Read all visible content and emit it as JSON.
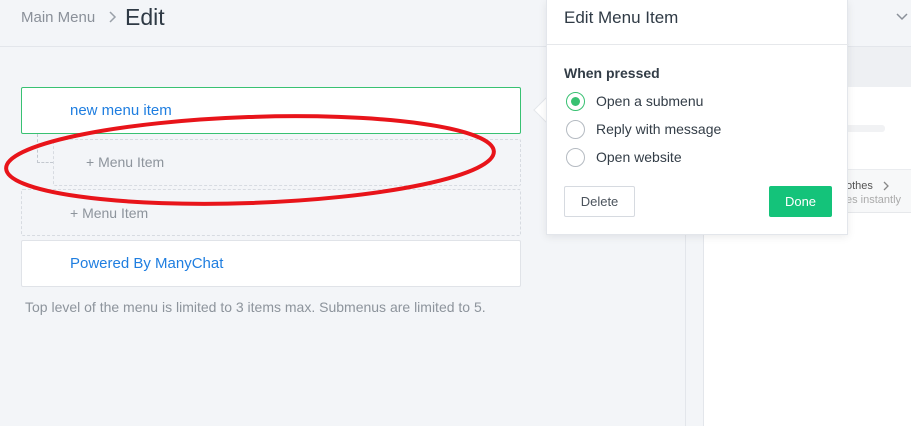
{
  "breadcrumb": {
    "main": "Main Menu",
    "current": "Edit"
  },
  "menu": {
    "active_item": "new menu item",
    "sub_add": "+ Menu Item",
    "top_add": "+ Menu Item",
    "powered": "Powered By ManyChat"
  },
  "hint": "Top level of the menu is limited to 3 items max. Submenus are limited to 5.",
  "popover": {
    "title": "Edit Menu Item",
    "section_label": "When pressed",
    "options": [
      {
        "label": "Open a submenu",
        "checked": true
      },
      {
        "label": "Reply with message",
        "checked": false
      },
      {
        "label": "Open website",
        "checked": false
      }
    ],
    "delete_label": "Delete",
    "done_label": "Done"
  },
  "preview": {
    "item_title": "othes",
    "item_sub": "es instantly"
  },
  "colors": {
    "accent_green": "#14c37a",
    "link_blue": "#1f7ee0",
    "annotation_red": "#e8141a"
  }
}
